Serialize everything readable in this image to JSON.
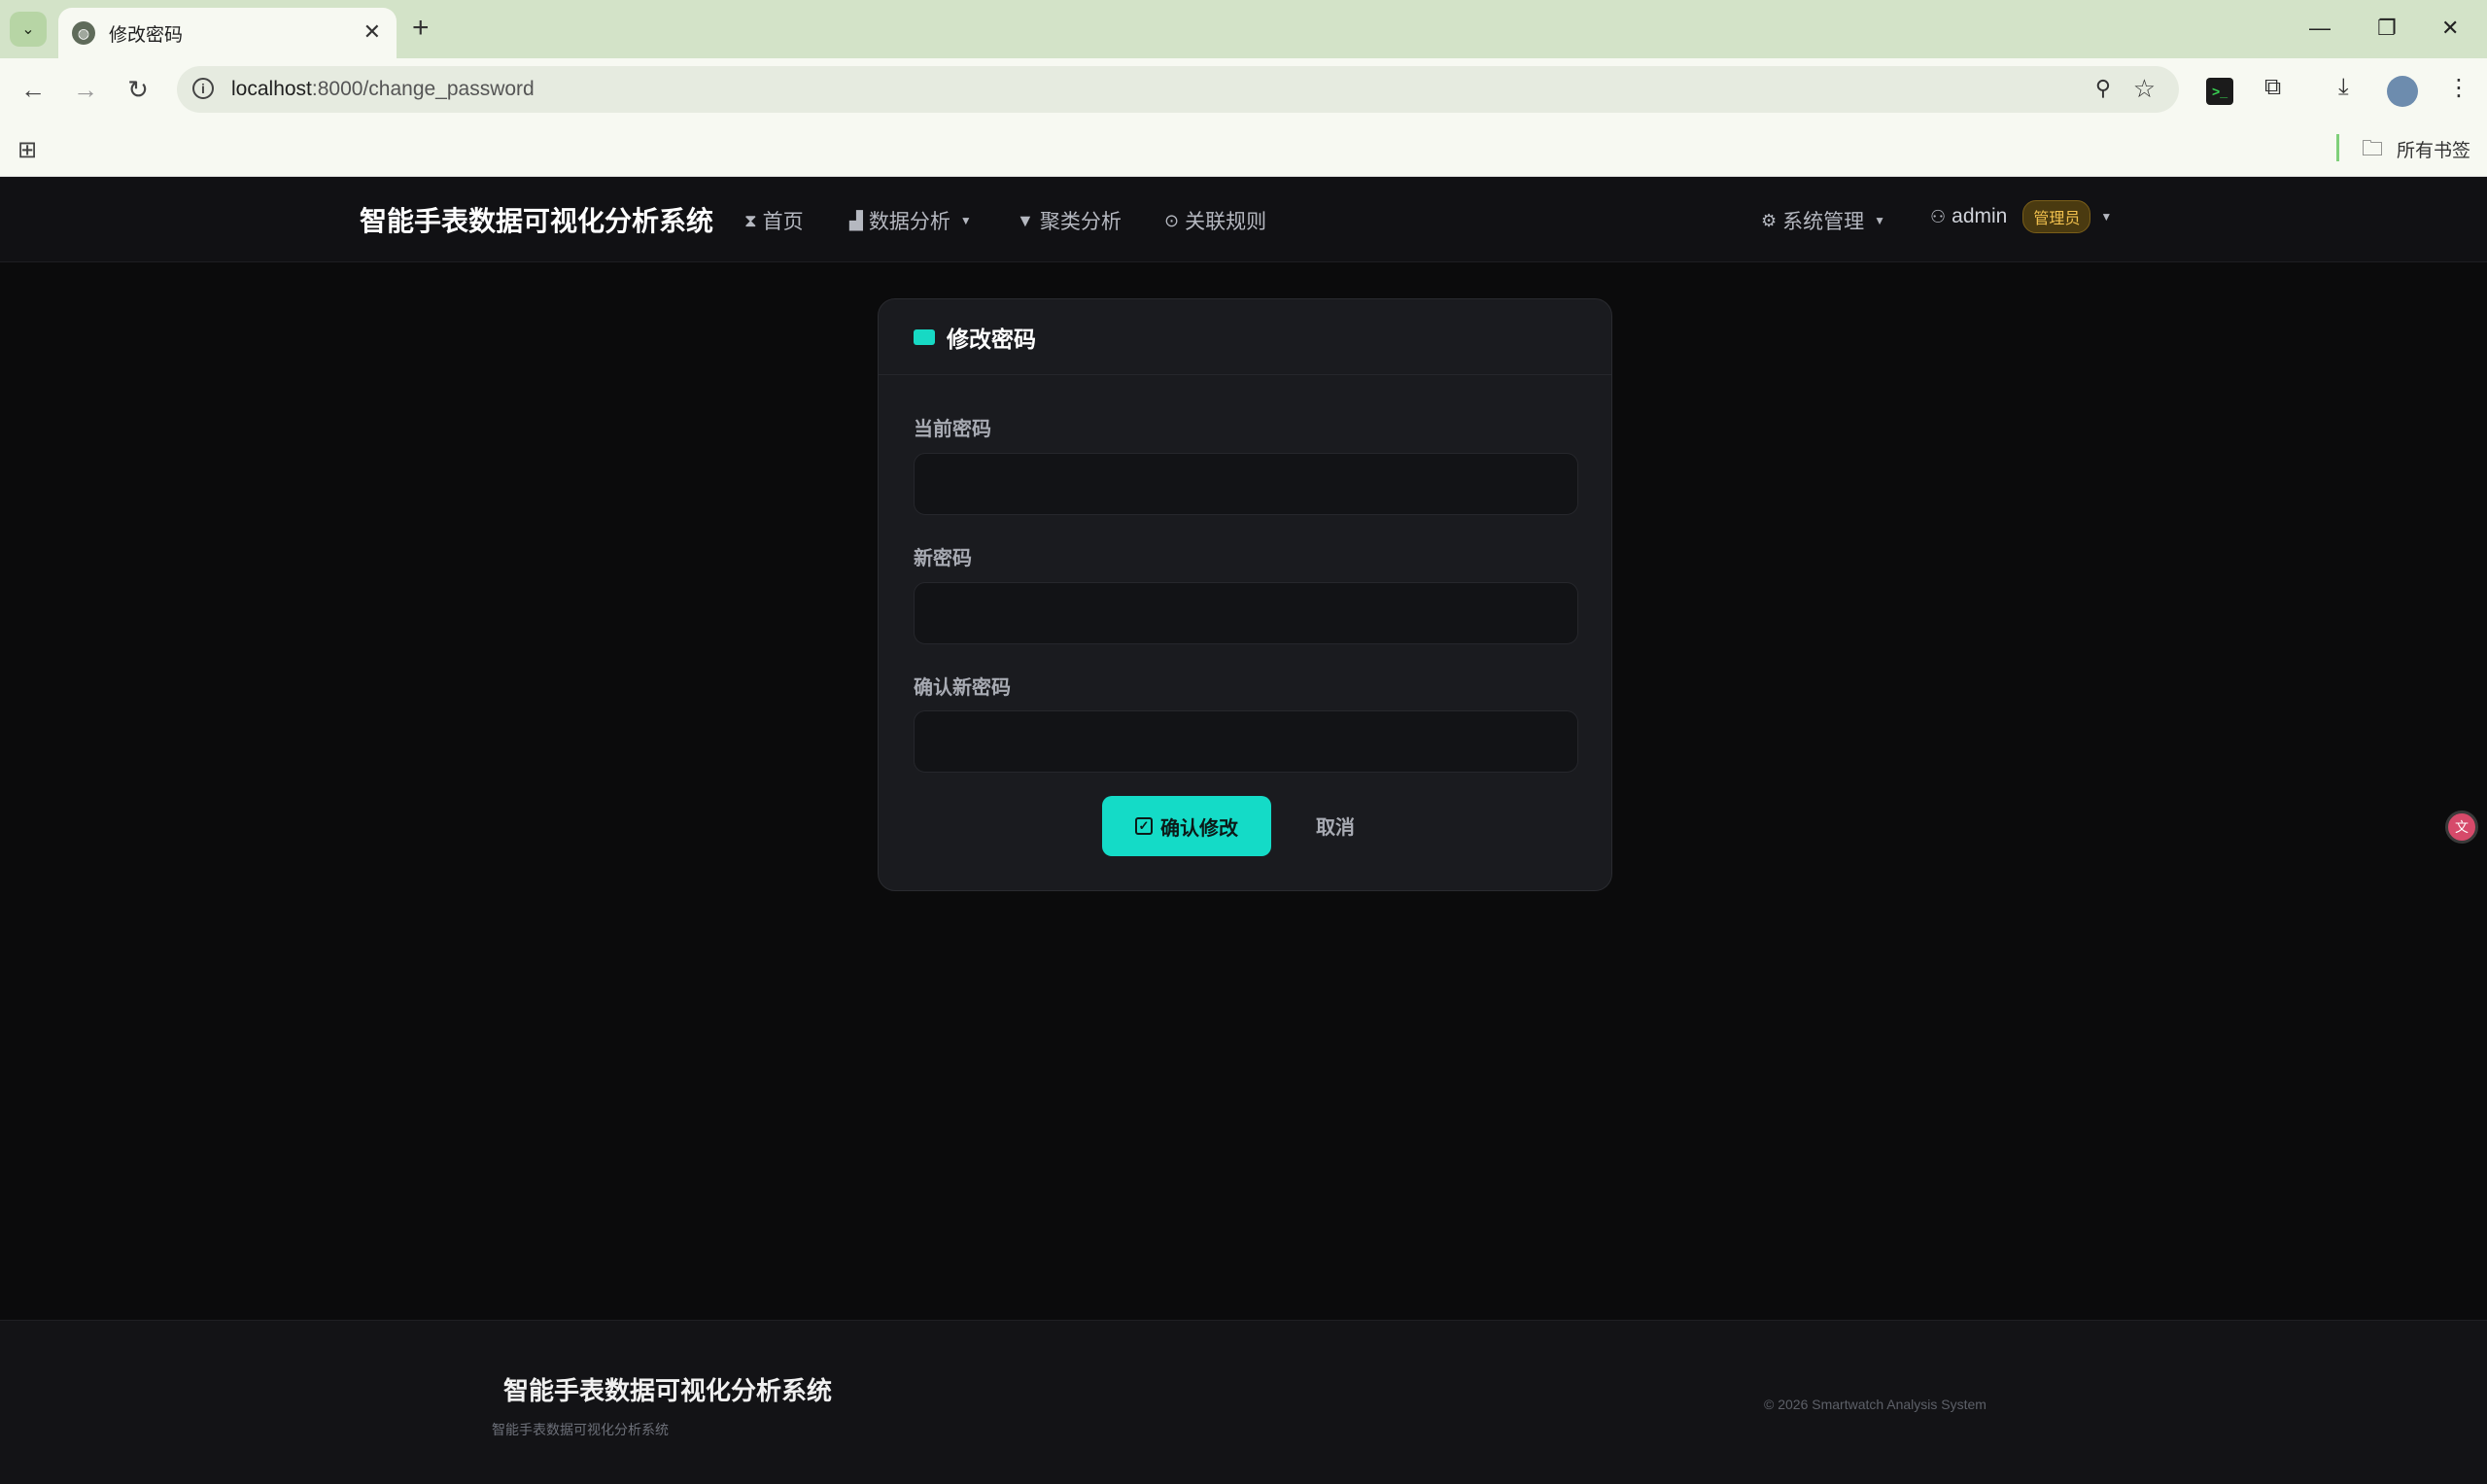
{
  "browser": {
    "tab_title": "修改密码",
    "url_host": "localhost",
    "url_rest": ":8000/change_password",
    "bookmarks_label": "所有书签"
  },
  "nav": {
    "brand": "智能手表数据可视化分析系统",
    "items": [
      {
        "label": "首页",
        "icon": "hourglass-icon"
      },
      {
        "label": "数据分析",
        "icon": "bar-chart-icon"
      },
      {
        "label": "聚类分析",
        "icon": "thumb-down-icon"
      },
      {
        "label": "关联规则",
        "icon": "controller-icon"
      }
    ],
    "system": "系统管理",
    "user": "admin",
    "role_badge": "管理员"
  },
  "card": {
    "title": "修改密码",
    "fields": [
      {
        "label": "当前密码",
        "value": ""
      },
      {
        "label": "新密码",
        "value": ""
      },
      {
        "label": "确认新密码",
        "value": ""
      }
    ],
    "confirm_label": "确认修改",
    "cancel_label": "取消"
  },
  "footer": {
    "brand": "智能手表数据可视化分析系统",
    "subtitle": "智能手表数据可视化分析系统",
    "copyright": "© 2026 Smartwatch Analysis System"
  },
  "colors": {
    "accent": "#14dbc7",
    "background": "#0b0b0c",
    "card": "#1a1b1f",
    "badge": "#f2c14e"
  }
}
